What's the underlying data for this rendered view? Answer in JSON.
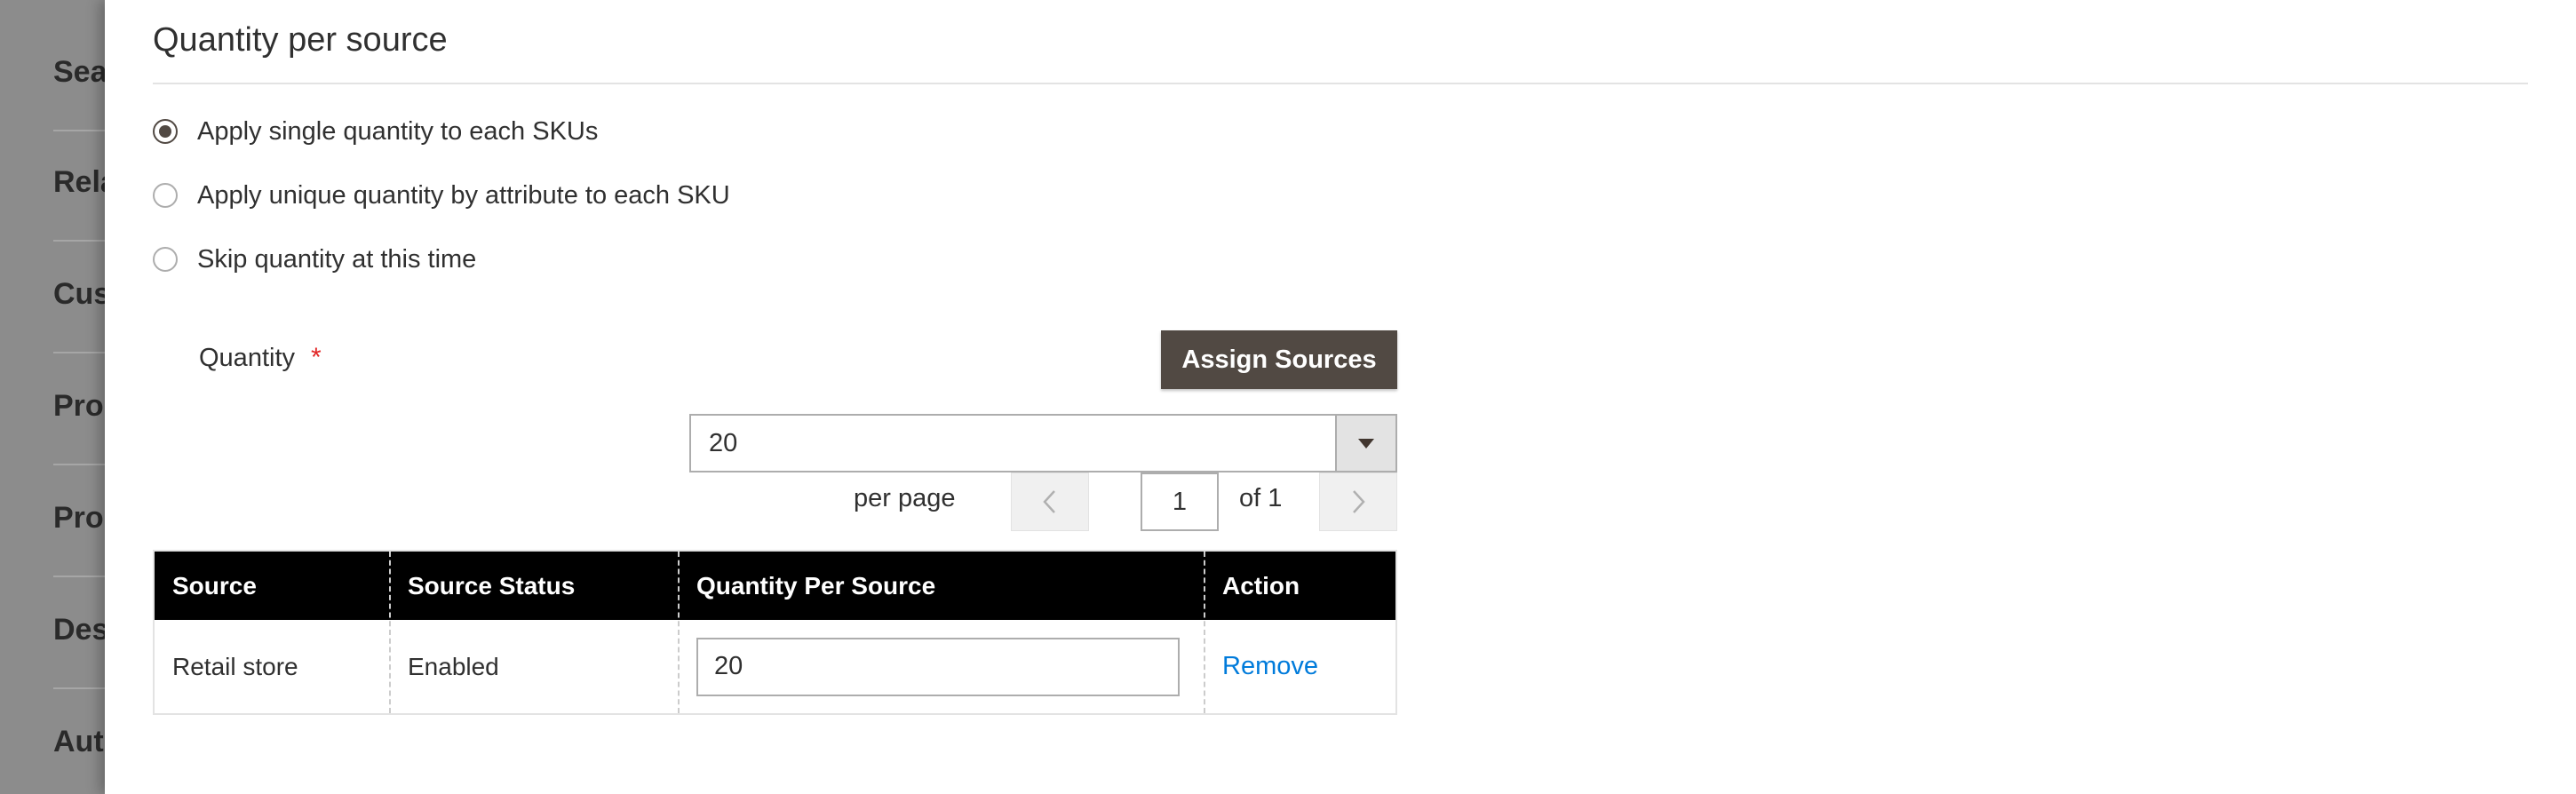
{
  "background_sidebar": {
    "items": [
      "Sea",
      "Rela",
      "Cus",
      "Pro",
      "Pro",
      "Des",
      "Aut"
    ]
  },
  "section": {
    "title": "Quantity per source"
  },
  "options": [
    {
      "label": "Apply single quantity to each SKUs",
      "checked": true
    },
    {
      "label": "Apply unique quantity by attribute to each SKU",
      "checked": false
    },
    {
      "label": "Skip quantity at this time",
      "checked": false
    }
  ],
  "quantity": {
    "label": "Quantity",
    "required_mark": "*",
    "assign_button": "Assign Sources"
  },
  "pager": {
    "per_page_value": "20",
    "per_page_label": "per page",
    "current_page": "1",
    "of_label": "of 1"
  },
  "grid": {
    "headers": [
      "Source",
      "Source Status",
      "Quantity Per Source",
      "Action"
    ],
    "rows": [
      {
        "source": "Retail store",
        "status": "Enabled",
        "quantity": "20",
        "action": "Remove"
      }
    ]
  },
  "colors": {
    "primary_button": "#514943",
    "link": "#007bdb",
    "required": "#e22626",
    "grid_header": "#000000"
  },
  "icons": [
    "chevron-left-icon",
    "chevron-right-icon",
    "dropdown-arrow-icon"
  ]
}
